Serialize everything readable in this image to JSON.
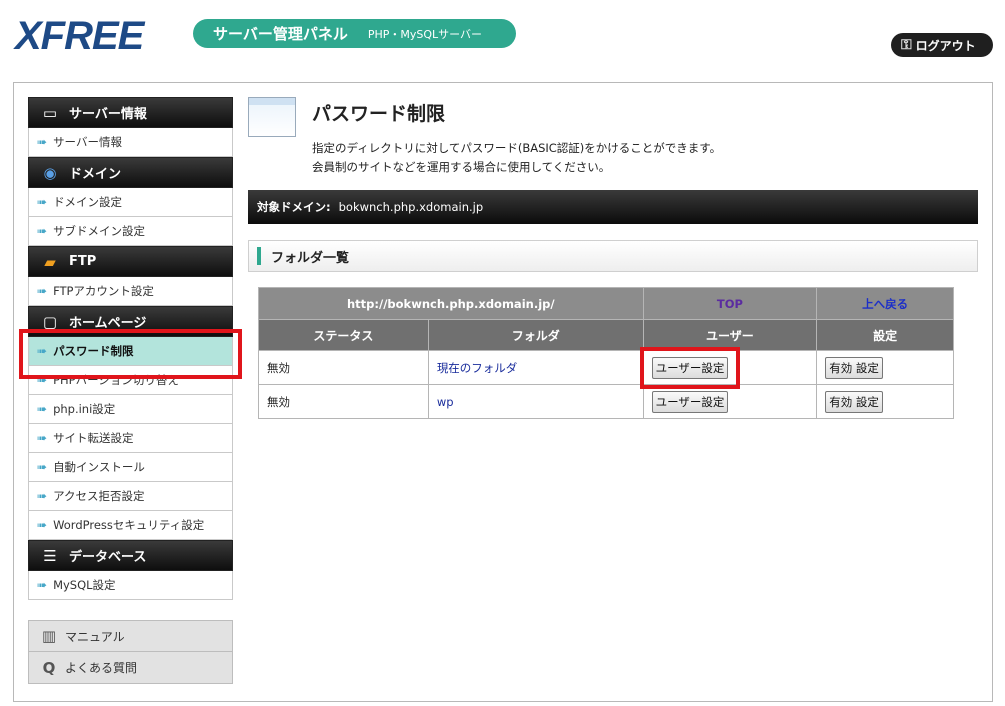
{
  "header": {
    "logo": "XFREE",
    "panel_title": "サーバー管理パネル",
    "panel_sub": "PHP・MySQLサーバー",
    "logout_label": "ログアウト"
  },
  "sidebar": {
    "sections": [
      {
        "title": "サーバー情報",
        "icon": "server-icon",
        "items": [
          "サーバー情報"
        ]
      },
      {
        "title": "ドメイン",
        "icon": "globe-icon",
        "items": [
          "ドメイン設定",
          "サブドメイン設定"
        ]
      },
      {
        "title": "FTP",
        "icon": "folder-icon",
        "items": [
          "FTPアカウント設定"
        ]
      },
      {
        "title": "ホームページ",
        "icon": "window-icon",
        "items": [
          "パスワード制限",
          "PHPバージョン切り替え",
          "php.ini設定",
          "サイト転送設定",
          "自動インストール",
          "アクセス拒否設定",
          "WordPressセキュリティ設定"
        ]
      },
      {
        "title": "データベース",
        "icon": "database-icon",
        "items": [
          "MySQL設定"
        ]
      }
    ],
    "active_item": "パスワード制限",
    "bottom": [
      {
        "label": "マニュアル",
        "icon": "book-icon"
      },
      {
        "label": "よくある質問",
        "icon": "question-icon"
      }
    ]
  },
  "main": {
    "title": "パスワード制限",
    "desc_line1": "指定のディレクトリに対してパスワード(BASIC認証)をかけることができます。",
    "desc_line2": "会員制のサイトなどを運用する場合に使用してください。",
    "domain_label": "対象ドメイン:",
    "domain_value": "bokwnch.php.xdomain.jp",
    "folder_list_title": "フォルダ一覧",
    "table": {
      "url": "http://bokwnch.php.xdomain.jp/",
      "top_link": "TOP",
      "up_link": "上へ戻る",
      "headers": [
        "ステータス",
        "フォルダ",
        "ユーザー",
        "設定"
      ],
      "rows": [
        {
          "status": "無効",
          "folder": "現在のフォルダ",
          "user_btn": "ユーザー設定",
          "set_btn": "有効 設定"
        },
        {
          "status": "無効",
          "folder": "wp",
          "user_btn": "ユーザー設定",
          "set_btn": "有効 設定"
        }
      ]
    }
  }
}
